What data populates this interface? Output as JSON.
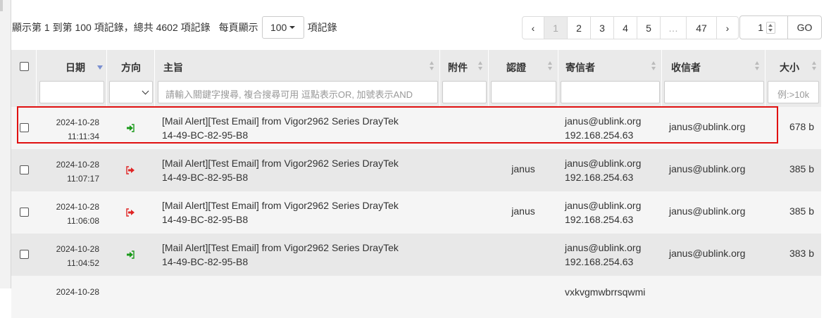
{
  "pagination_info": {
    "text_before": "顯示第 1 到第 100 項記錄，總共 4602 項記錄",
    "per_page_label": "每頁顯示",
    "per_page_value": "100",
    "text_after": "項記錄"
  },
  "pager": {
    "prev": "‹",
    "pages": [
      "1",
      "2",
      "3",
      "4",
      "5",
      "…",
      "47"
    ],
    "active": "1",
    "next": "›",
    "goto_value": "1",
    "go_label": "GO"
  },
  "columns": {
    "date": "日期",
    "direction": "方向",
    "subject": "主旨",
    "attachment": "附件",
    "certification": "認證",
    "sender": "寄信者",
    "recipient": "收信者",
    "size": "大小"
  },
  "filters": {
    "subject_placeholder": "請輸入關鍵字搜尋, 複合搜尋可用 逗點表示OR,  加號表示AND",
    "size_placeholder": "例:>10k"
  },
  "rows": [
    {
      "date": "2024-10-28",
      "time": "11:11:34",
      "direction": "in",
      "subject_line1": "[Mail Alert][Test Email] from Vigor2962 Series DrayTek",
      "subject_line2": "14-49-BC-82-95-B8",
      "attachment": "",
      "cert": "",
      "sender_email": "janus@ublink.org",
      "sender_ip": "192.168.254.63",
      "recipient": "janus@ublink.org",
      "size": "678 b"
    },
    {
      "date": "2024-10-28",
      "time": "11:07:17",
      "direction": "out",
      "subject_line1": "[Mail Alert][Test Email] from Vigor2962 Series DrayTek",
      "subject_line2": "14-49-BC-82-95-B8",
      "attachment": "",
      "cert": "janus",
      "sender_email": "janus@ublink.org",
      "sender_ip": "192.168.254.63",
      "recipient": "janus@ublink.org",
      "size": "385 b"
    },
    {
      "date": "2024-10-28",
      "time": "11:06:08",
      "direction": "out",
      "subject_line1": "[Mail Alert][Test Email] from Vigor2962 Series DrayTek",
      "subject_line2": "14-49-BC-82-95-B8",
      "attachment": "",
      "cert": "janus",
      "sender_email": "janus@ublink.org",
      "sender_ip": "192.168.254.63",
      "recipient": "janus@ublink.org",
      "size": "385 b"
    },
    {
      "date": "2024-10-28",
      "time": "11:04:52",
      "direction": "in",
      "subject_line1": "[Mail Alert][Test Email] from Vigor2962 Series DrayTek",
      "subject_line2": "14-49-BC-82-95-B8",
      "attachment": "",
      "cert": "",
      "sender_email": "janus@ublink.org",
      "sender_ip": "192.168.254.63",
      "recipient": "janus@ublink.org",
      "size": "383 b"
    },
    {
      "date": "2024-10-28",
      "sender_email": "vxkvgmwbrrsqwmi"
    }
  ],
  "colors": {
    "incoming_icon": "#1a9a1a",
    "outgoing_icon": "#e02424",
    "highlight_border": "#e01010",
    "sort_indicator": "#7a8fd0"
  }
}
